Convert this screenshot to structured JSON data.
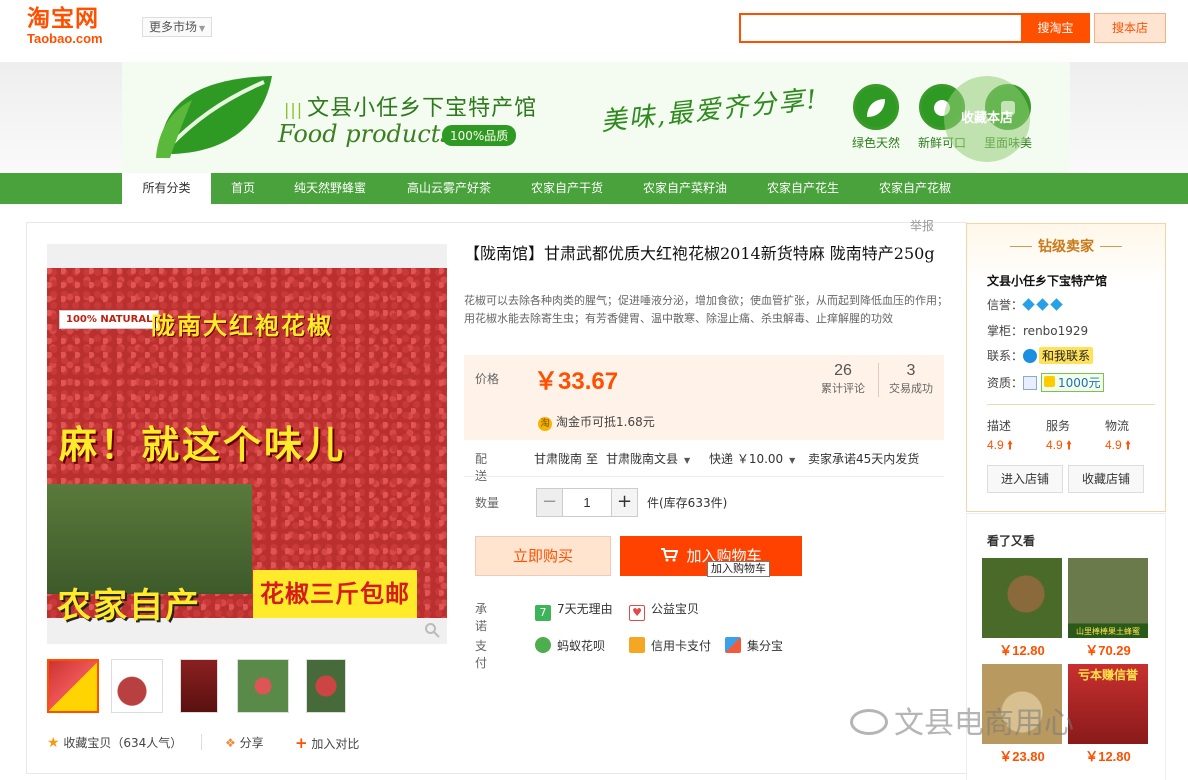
{
  "header": {
    "logo_cn": "淘宝网",
    "logo_en": "Taobao.com",
    "more_market": "更多市场",
    "search_value": "",
    "search_button": "搜淘宝",
    "search_shop_button": "搜本店"
  },
  "banner": {
    "shop_name": "文县小任乡下宝特产馆",
    "shop_name_en": "Food products",
    "quality_badge": "100%品质",
    "slogan": "美味,最爱齐分享!",
    "features": [
      "绿色天然",
      "新鲜可口",
      "里面味美"
    ],
    "favorite_store": "收藏本店"
  },
  "nav": {
    "items": [
      "所有分类",
      "首页",
      "纯天然野蜂蜜",
      "高山云雾产好茶",
      "农家自产干货",
      "农家自产菜籽油",
      "农家自产花生",
      "农家自产花椒"
    ],
    "active_index": 0
  },
  "report": "举报",
  "gallery": {
    "main_image_texts": {
      "badge": "100% NATURAL",
      "headline": "陇南大红袍花椒",
      "tagline": "麻！就这个味儿",
      "farm": "农家自产",
      "promo": "花椒三斤包邮"
    },
    "thumbnail_count": 5,
    "active_thumbnail": 0
  },
  "bottom_actions": {
    "favorite": "收藏宝贝（634人气）",
    "share": "分享",
    "compare": "加入对比"
  },
  "product": {
    "title": "【陇南馆】甘肃武都优质大红袍花椒2014新货特麻 陇南特产250g",
    "subtitle": "花椒可以去除各种肉类的腥气；促进唾液分泌，增加食欲；使血管扩张，从而起到降低血压的作用；用花椒水能去除寄生虫；有芳香健胃、温中散寒、除湿止痛、杀虫解毒、止痒解腥的功效",
    "price_label": "价格",
    "price": "￥33.67",
    "reviews_count": "26",
    "reviews_label": "累计评论",
    "trades_count": "3",
    "trades_label": "交易成功",
    "coin_text": "淘金币可抵1.68元",
    "coin_icon": "淘"
  },
  "shipping": {
    "label": "配送",
    "from": "甘肃陇南",
    "to_word": "至",
    "to": "甘肃陇南文县",
    "method": "快递 ￥10.00",
    "promise": "卖家承诺45天内发货"
  },
  "quantity": {
    "label": "数量",
    "value": "1",
    "minus": "−",
    "plus": "+",
    "stock": "件(库存633件)"
  },
  "buttons": {
    "buy_now": "立即购买",
    "add_to_cart": "加入购物车",
    "tooltip": "加入购物车"
  },
  "services": {
    "promise_label": "承诺",
    "promise_items": [
      "7天无理由",
      "公益宝贝"
    ],
    "pay_label": "支付",
    "pay_items": [
      "蚂蚁花呗",
      "信用卡支付",
      "集分宝"
    ]
  },
  "seller": {
    "rank": "钻级卖家",
    "name": "文县小任乡下宝特产馆",
    "credit_label": "信誉：",
    "credit_diamonds": 3,
    "owner_label": "掌柜：",
    "owner": "renbo1929",
    "contact_label": "联系：",
    "contact": "和我联系",
    "qual_label": "资质：",
    "deposit": "1000元",
    "dsr": [
      {
        "name": "描述",
        "score": "4.9"
      },
      {
        "name": "服务",
        "score": "4.9"
      },
      {
        "name": "物流",
        "score": "4.9"
      }
    ],
    "enter_store": "进入店铺",
    "favorite_store": "收藏店铺"
  },
  "see_also": {
    "title": "看了又看",
    "items": [
      {
        "price": "￥12.80",
        "caption": ""
      },
      {
        "price": "￥70.29",
        "caption": "山里棒棒果土蜂蜜"
      },
      {
        "price": "￥23.80",
        "caption": ""
      },
      {
        "price": "￥12.80",
        "caption": "亏本赚信誉"
      }
    ]
  },
  "watermark": "文县电商用心",
  "colors": {
    "taobao_orange": "#ff5000",
    "nav_green": "#49a23b",
    "price_bg": "#fff2e8",
    "seller_border": "#f3d5a8"
  }
}
